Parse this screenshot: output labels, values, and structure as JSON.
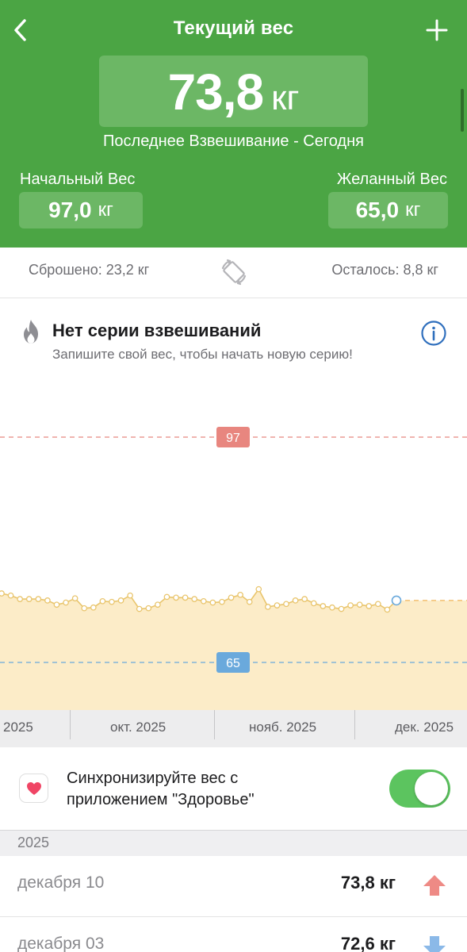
{
  "header": {
    "title": "Текущий вес",
    "current_value": "73,8",
    "current_unit": "кг",
    "last_weighing": "Последнее Взвешивание - Сегодня",
    "start_label": "Начальный Вес",
    "start_value": "97,0",
    "start_unit": "кг",
    "goal_label": "Желанный Вес",
    "goal_value": "65,0",
    "goal_unit": "кг",
    "colors": {
      "background": "#4ba544",
      "box": "#6cb765"
    },
    "icons": {
      "back": "chevron-left-icon",
      "add": "plus-icon"
    }
  },
  "stats": {
    "lost": "Сброшено: 23,2 кг",
    "remaining": "Осталось: 8,8 кг",
    "toggle_icon": "swap-rotate-icon"
  },
  "streak": {
    "title": "Нет серии взвешиваний",
    "subtitle": "Запишите свой вес, чтобы начать новую серию!",
    "icon": "flame-icon",
    "info_icon": "info-icon"
  },
  "chart_data": {
    "type": "area",
    "x_labels": [
      "2025",
      "окт. 2025",
      "нояб. 2025",
      "дек. 2025"
    ],
    "reference_lines": [
      {
        "value": 97,
        "label": "97",
        "color": "#e8867f"
      },
      {
        "value": 65,
        "label": "65",
        "color": "#6aa9dc"
      }
    ],
    "ylim": [
      58,
      120
    ],
    "series": [
      {
        "color": "#e9c56d",
        "fill": "#fcecc8",
        "points": [
          [
            0,
            74.8
          ],
          [
            1,
            74.5
          ],
          [
            2,
            74.0
          ],
          [
            3,
            74.0
          ],
          [
            4,
            74.0
          ],
          [
            5,
            73.8
          ],
          [
            6,
            73.2
          ],
          [
            7,
            73.5
          ],
          [
            8,
            74.1
          ],
          [
            9,
            72.7
          ],
          [
            10,
            72.8
          ],
          [
            11,
            73.7
          ],
          [
            12,
            73.6
          ],
          [
            13,
            73.8
          ],
          [
            14,
            74.5
          ],
          [
            15,
            72.6
          ],
          [
            16,
            72.7
          ],
          [
            17,
            73.2
          ],
          [
            18,
            74.3
          ],
          [
            19,
            74.2
          ],
          [
            20,
            74.2
          ],
          [
            21,
            74.0
          ],
          [
            22,
            73.7
          ],
          [
            23,
            73.5
          ],
          [
            24,
            73.6
          ],
          [
            25,
            74.2
          ],
          [
            26,
            74.6
          ],
          [
            27,
            73.6
          ],
          [
            28,
            75.4
          ],
          [
            29,
            72.9
          ],
          [
            30,
            73.1
          ],
          [
            31,
            73.3
          ],
          [
            32,
            73.8
          ],
          [
            33,
            74.0
          ],
          [
            34,
            73.4
          ],
          [
            35,
            73.0
          ],
          [
            36,
            72.8
          ],
          [
            37,
            72.6
          ],
          [
            38,
            73.1
          ],
          [
            39,
            73.2
          ],
          [
            40,
            73.0
          ],
          [
            41,
            73.3
          ],
          [
            42,
            72.5
          ],
          [
            43,
            73.8
          ]
        ]
      }
    ]
  },
  "health": {
    "text_line1": "Синхронизируйте вес с",
    "text_line2": "приложением \"Здоровье\"",
    "toggle_on": true,
    "icon": "heart-icon"
  },
  "history": {
    "year": "2025",
    "entries": [
      {
        "date": "декабря 10",
        "weight": "73,8 кг",
        "trend": "up",
        "icon": "arrow-up-icon"
      },
      {
        "date": "декабря 03",
        "weight": "72,6 кг",
        "trend": "down",
        "icon": "arrow-down-icon"
      }
    ]
  }
}
